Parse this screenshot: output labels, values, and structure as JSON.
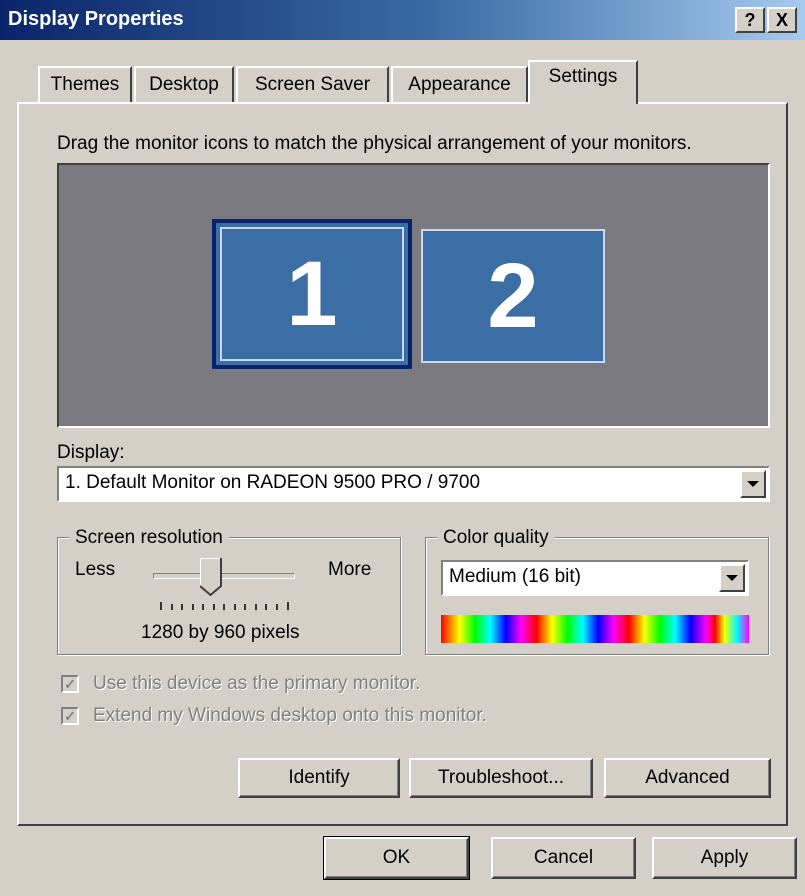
{
  "window": {
    "title": "Display Properties",
    "help_button": "?",
    "close_button": "X"
  },
  "tabs": [
    {
      "label": "Themes"
    },
    {
      "label": "Desktop"
    },
    {
      "label": "Screen Saver"
    },
    {
      "label": "Appearance"
    },
    {
      "label": "Settings",
      "active": true
    }
  ],
  "settings": {
    "instruction": "Drag the monitor icons to match the physical arrangement of your monitors.",
    "monitors": [
      {
        "number": "1",
        "selected": true
      },
      {
        "number": "2",
        "selected": false
      }
    ],
    "display_label": "Display:",
    "display_value": "1. Default Monitor on RADEON 9500 PRO / 9700",
    "resolution": {
      "group_title": "Screen resolution",
      "less_label": "Less",
      "more_label": "More",
      "value_text": "1280 by 960 pixels",
      "slider_fraction": 0.4
    },
    "color_quality": {
      "group_title": "Color quality",
      "value": "Medium (16 bit)"
    },
    "checkboxes": [
      {
        "label": "Use this device as the primary monitor.",
        "checked": true,
        "enabled": false
      },
      {
        "label": "Extend my Windows desktop onto this monitor.",
        "checked": true,
        "enabled": false
      }
    ],
    "buttons": {
      "identify": "Identify",
      "troubleshoot": "Troubleshoot...",
      "advanced": "Advanced"
    }
  },
  "footer": {
    "ok": "OK",
    "cancel": "Cancel",
    "apply": "Apply"
  },
  "colors": {
    "title_bar_start": "#0a246a",
    "title_bar_end": "#a6caf0",
    "monitor_fill": "#3a6ea5",
    "monitor_area": "#7c7a81",
    "dialog_face": "#d4d0c8"
  }
}
